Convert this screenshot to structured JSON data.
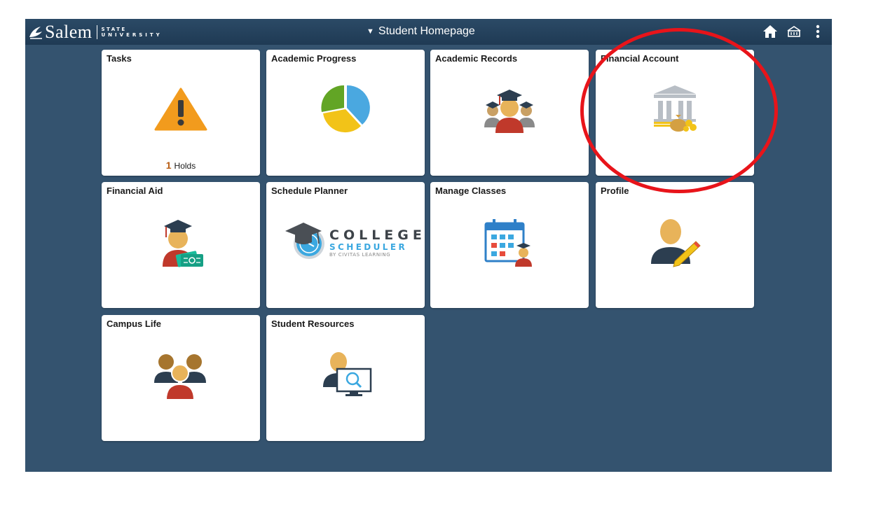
{
  "header": {
    "logo_name": "Salem",
    "logo_sub_top": "STATE",
    "logo_sub_bottom": "UNIVERSITY",
    "title": "Student Homepage",
    "title_caret": "▼"
  },
  "tiles": [
    {
      "title": "Tasks",
      "count_value": "1",
      "count_label": "Holds",
      "icon": "warning-icon"
    },
    {
      "title": "Academic Progress",
      "icon": "pie-chart-icon"
    },
    {
      "title": "Academic Records",
      "icon": "graduates-icon"
    },
    {
      "title": "Financial Account",
      "icon": "bank-money-icon"
    },
    {
      "title": "Financial Aid",
      "icon": "graduate-cash-icon"
    },
    {
      "title": "Schedule Planner",
      "icon": "college-scheduler-logo",
      "logo_line1": "COLLEGE",
      "logo_line2": "SCHEDULER",
      "logo_line3": "BY CIVITAS LEARNING"
    },
    {
      "title": "Manage Classes",
      "icon": "calendar-student-icon"
    },
    {
      "title": "Profile",
      "icon": "person-pencil-icon"
    },
    {
      "title": "Campus Life",
      "icon": "people-group-icon"
    },
    {
      "title": "Student Resources",
      "icon": "person-monitor-search-icon"
    }
  ],
  "colors": {
    "banner": "#1f3a54",
    "background": "#34536f",
    "highlight": "#e8141a",
    "warning": "#f29b1d",
    "pie_blue": "#4aa8e0",
    "pie_yellow": "#f2c318",
    "pie_green": "#62a525",
    "skin": "#e8b35a",
    "red": "#c0392b",
    "navy": "#2c3e50"
  }
}
